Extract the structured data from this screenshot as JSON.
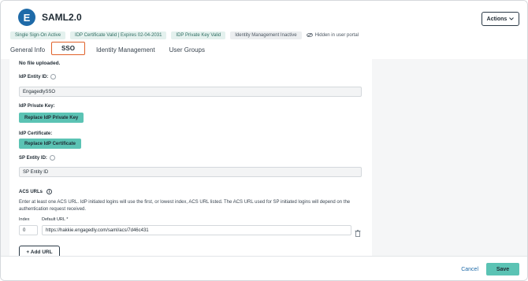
{
  "app": {
    "avatar_letter": "E",
    "title": "SAML2.0",
    "actions_label": "Actions"
  },
  "badges": [
    "Single Sign-On Active",
    "IDP Certificate Valid | Expires 02-04-2031",
    "IDP Private Key Valid",
    "Identity Management Inactive"
  ],
  "hidden_note": "Hidden in user portal",
  "tabs": [
    "General Info",
    "SSO",
    "Identity Management",
    "User Groups"
  ],
  "active_tab": "SSO",
  "form": {
    "no_file_text": "No file uploaded.",
    "idp_entity_label": "IdP Entity ID:",
    "idp_entity_value": "EngagedlySSO",
    "idp_private_key_label": "IdP Private Key:",
    "replace_key_label": "Replace IdP Private Key",
    "idp_cert_label": "IdP Certificate:",
    "replace_cert_label": "Replace IdP Certificate",
    "sp_entity_label": "SP Entity ID:",
    "sp_entity_value": "SP Entity ID",
    "acs_title": "ACS URLs",
    "acs_help": "Enter at least one ACS URL. IdP initiated logins will use the first, or lowest index, ACS URL listed. The ACS URL used for SP initiated logins will depend on the authentication request received.",
    "index_label": "Index",
    "default_url_label": "Default URL *",
    "index_value": "0",
    "url_value": "https://hakkie.engagedly.com/saml/acs/7d46c431",
    "add_url_label": "+ Add URL"
  },
  "footer": {
    "cancel_label": "Cancel",
    "save_label": "Save"
  },
  "colors": {
    "accent_teal": "#5bc3b4",
    "active_tab_border": "#e0612a",
    "avatar_blue": "#1e6aa8"
  }
}
